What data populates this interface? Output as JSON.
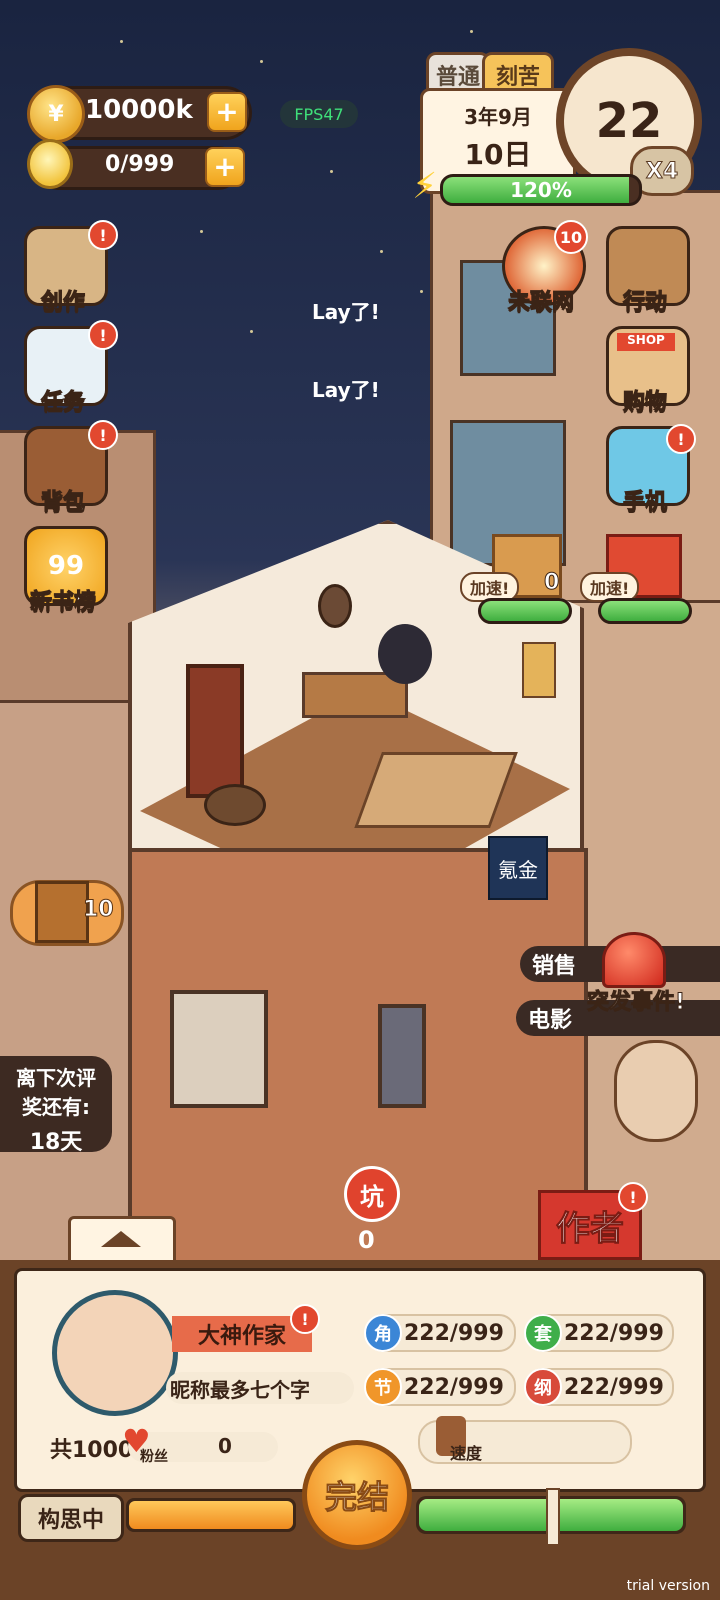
{
  "hud": {
    "coins": "10000k",
    "ideas": "0/999",
    "fps": "FPS47",
    "difficulty_tabs": [
      "普通",
      "刻苦"
    ],
    "date_year_month": "3年9月",
    "date_day": "10日",
    "clock_hour": "22",
    "time_speed": "X4",
    "energy_text": "120%",
    "energy_level": 0.95
  },
  "left_menu": [
    {
      "label": "创作",
      "badge": "!"
    },
    {
      "label": "任务",
      "badge": "!"
    },
    {
      "label": "背包",
      "badge": "!"
    },
    {
      "label": "新书榜",
      "badge": ""
    }
  ],
  "right_menu": [
    {
      "label": "未联网",
      "badge": "10"
    },
    {
      "label": "行动",
      "badge": ""
    },
    {
      "label": "购物",
      "badge": ""
    },
    {
      "label": "手机",
      "badge": "!"
    }
  ],
  "new_books_badge": "99",
  "shop_sign": "SHOP",
  "floating_texts": [
    "Lay了!",
    "Lay了!"
  ],
  "deliveries": [
    {
      "label": "加速!",
      "count": "0",
      "progress": 1.0
    },
    {
      "label": "加速!",
      "count": "",
      "progress": 1.0
    }
  ],
  "building_sign": "氪金",
  "chest_count": "10",
  "review": {
    "line1": "离下次评",
    "line2": "奖还有:",
    "days": "18天"
  },
  "events": {
    "line1": "销售",
    "line2": "电影",
    "popup": "突发事件!"
  },
  "pit": {
    "label": "坑",
    "count": "0"
  },
  "author_button": "作者",
  "profile": {
    "rank": "大神作家",
    "nickname": "昵称最多七个字",
    "total_prefix": "共1000",
    "fans_label": "粉丝",
    "fans_count": "0",
    "speed_label": "速度"
  },
  "stats": [
    {
      "icon": "角",
      "value": "222/999",
      "color": "#3b86d6"
    },
    {
      "icon": "套",
      "value": "222/999",
      "color": "#3fae4a"
    },
    {
      "icon": "节",
      "value": "222/999",
      "color": "#f0962a"
    },
    {
      "icon": "纲",
      "value": "222/999",
      "color": "#d84a3a"
    }
  ],
  "finish_button": "完结",
  "status": "构思中",
  "progress_idea": 1.0,
  "progress_write": 1.0,
  "watermark": "trial version"
}
